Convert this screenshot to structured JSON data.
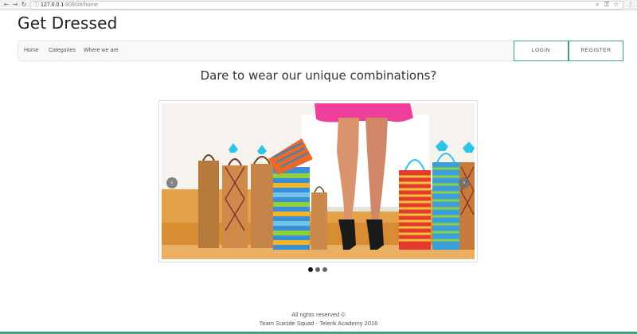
{
  "browser": {
    "url_host": "127.0.0.1",
    "url_rest": ":8080/#/home",
    "back_icon": "back-arrow-icon",
    "forward_icon": "forward-arrow-icon",
    "reload_icon": "reload-icon"
  },
  "header": {
    "title": "Get Dressed"
  },
  "nav": {
    "items": [
      {
        "label": "Home"
      },
      {
        "label": "Categories"
      },
      {
        "label": "Where we are"
      }
    ],
    "login_label": "LOGIN",
    "register_label": "REGISTER"
  },
  "main": {
    "tagline": "Dare to wear our unique combinations?",
    "carousel": {
      "prev_icon": "chevron-left-icon",
      "next_icon": "chevron-right-icon",
      "slides_count": 3,
      "active_index": 0
    }
  },
  "footer": {
    "line1": "All rights reserved ©",
    "line2": "Team Suicide Squad - Telerik Academy 2016"
  },
  "colors": {
    "accent": "#3aa37a",
    "navbar_bg": "#f8f8f8"
  }
}
